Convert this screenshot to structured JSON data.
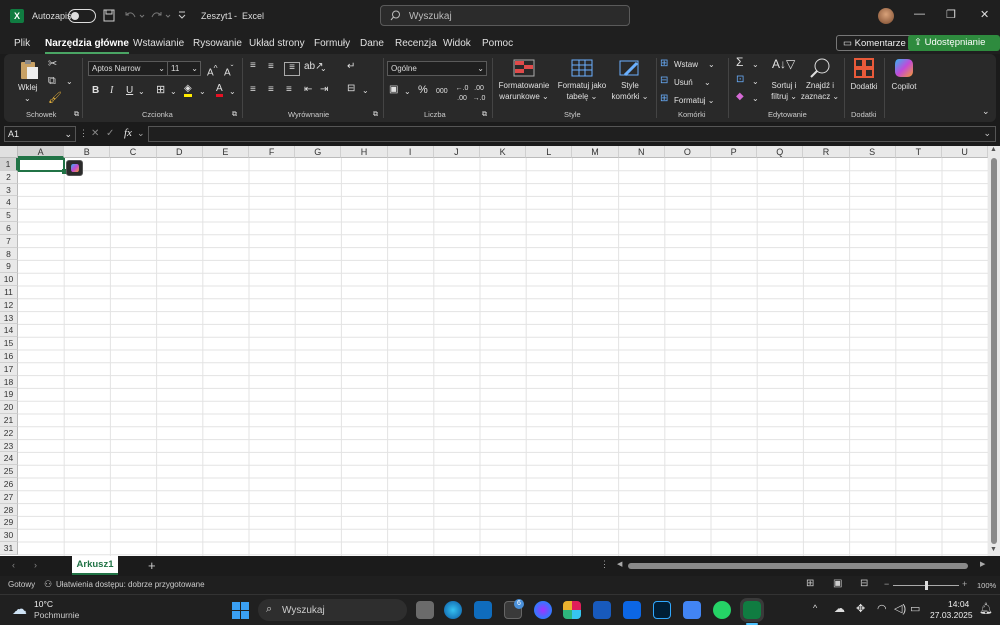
{
  "titlebar": {
    "autosave": "Autozapis",
    "doc_title": "Zeszyt1",
    "sep": "-",
    "app": "Excel",
    "search_placeholder": "Wyszukaj"
  },
  "menu": [
    "Plik",
    "Narzędzia główne",
    "Wstawianie",
    "Rysowanie",
    "Układ strony",
    "Formuły",
    "Dane",
    "Recenzja",
    "Widok",
    "Pomoc"
  ],
  "comments_btn": "Komentarze",
  "share_btn": "Udostępnianie",
  "ribbon": {
    "clipboard": {
      "paste": "Wklej",
      "label": "Schowek"
    },
    "font": {
      "name": "Aptos Narrow",
      "size": "11",
      "label": "Czcionka",
      "bold": "B",
      "italic": "I",
      "underline": "U",
      "grow": "A",
      "shrink": "A",
      "fontcolor": "A"
    },
    "align": {
      "label": "Wyrównanie"
    },
    "number": {
      "format": "Ogólne",
      "label": "Liczba",
      "percent": "%",
      "thousands": "000",
      "inc": ".0→.00",
      "dec": ".00→.0"
    },
    "styles": {
      "cond1": "Formatowanie",
      "cond2": "warunkowe",
      "table1": "Formatuj jako",
      "table2": "tabelę",
      "cell1": "Style",
      "cell2": "komórki",
      "label": "Style"
    },
    "cells": {
      "insert": "Wstaw",
      "delete": "Usuń",
      "format": "Formatuj",
      "label": "Komórki"
    },
    "editing": {
      "sort1": "Sortuj i",
      "sort2": "filtruj",
      "find1": "Znajdź i",
      "find2": "zaznacz",
      "label": "Edytowanie"
    },
    "addins": {
      "btn": "Dodatki",
      "label": "Dodatki"
    },
    "copilot": {
      "btn": "Copilot"
    }
  },
  "formula": {
    "namebox": "A1",
    "fx": "fx",
    "value": ""
  },
  "columns": [
    "A",
    "B",
    "C",
    "D",
    "E",
    "F",
    "G",
    "H",
    "I",
    "J",
    "K",
    "L",
    "M",
    "N",
    "O",
    "P",
    "Q",
    "R",
    "S",
    "T",
    "U"
  ],
  "rows": [
    "1",
    "2",
    "3",
    "4",
    "5",
    "6",
    "7",
    "8",
    "9",
    "10",
    "11",
    "12",
    "13",
    "14",
    "15",
    "16",
    "17",
    "18",
    "19",
    "20",
    "21",
    "22",
    "23",
    "24",
    "25",
    "26",
    "27",
    "28",
    "29",
    "30",
    "31"
  ],
  "sheet_tab": "Arkusz1",
  "add_sheet": "+",
  "status": {
    "ready": "Gotowy",
    "accessibility": "Ułatwienia dostępu: dobrze przygotowane",
    "zoom": "100%"
  },
  "taskbar": {
    "temp": "10°C",
    "weather": "Pochmurnie",
    "search": "Wyszukaj",
    "badge": "6",
    "time": "14:04",
    "date": "27.03.2025"
  },
  "colors": {
    "accent": "#107c41",
    "share": "#2e8b3e",
    "selection": "#217346"
  }
}
